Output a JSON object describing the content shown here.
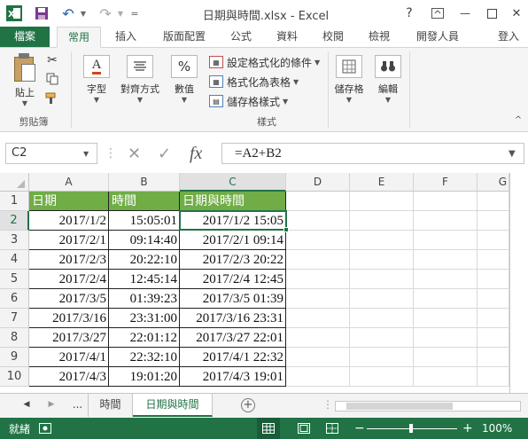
{
  "window": {
    "title": "日期與時間.xlsx - Excel",
    "help": "?",
    "qat_more": "=",
    "min": "—",
    "close": "✕"
  },
  "tabs": [
    "檔案",
    "常用",
    "插入",
    "版面配置",
    "公式",
    "資料",
    "校閱",
    "檢視",
    "開發人員"
  ],
  "signin": "登入",
  "ribbon": {
    "clipboard": {
      "paste": "貼上",
      "group": "剪貼簿"
    },
    "font": "字型",
    "alignment": "對齊方式",
    "number": "數值",
    "number_icon": "%",
    "styles": {
      "conditional": "設定格式化的條件",
      "as_table": "格式化為表格",
      "cell_styles": "儲存格樣式",
      "group": "樣式"
    },
    "cells": "儲存格",
    "editing": "編輯",
    "collapse": "^"
  },
  "formula_bar": {
    "name_box": "C2",
    "fx": "fx",
    "formula": "=A2+B2"
  },
  "grid": {
    "columns": [
      "A",
      "B",
      "C",
      "D",
      "E",
      "F",
      "G"
    ],
    "rows": [
      "1",
      "2",
      "3",
      "4",
      "5",
      "6",
      "7",
      "8",
      "9",
      "10"
    ],
    "header_row": [
      "日期",
      "時間",
      "日期與時間"
    ],
    "data": [
      [
        "2017/1/2",
        "15:05:01",
        "2017/1/2 15:05"
      ],
      [
        "2017/2/1",
        "09:14:40",
        "2017/2/1 09:14"
      ],
      [
        "2017/2/3",
        "20:22:10",
        "2017/2/3 20:22"
      ],
      [
        "2017/2/4",
        "12:45:14",
        "2017/2/4 12:45"
      ],
      [
        "2017/3/5",
        "01:39:23",
        "2017/3/5 01:39"
      ],
      [
        "2017/3/16",
        "23:31:00",
        "2017/3/16 23:31"
      ],
      [
        "2017/3/27",
        "22:01:12",
        "2017/3/27 22:01"
      ],
      [
        "2017/4/1",
        "22:32:10",
        "2017/4/1 22:32"
      ],
      [
        "2017/4/3",
        "19:01:20",
        "2017/4/3 19:01"
      ]
    ]
  },
  "sheets": {
    "ellipsis": "...",
    "tabs": [
      "時間",
      "日期與時間"
    ],
    "add": "+"
  },
  "status": {
    "ready": "就緒",
    "zoom": "100%",
    "zoom_minus": "−",
    "zoom_plus": "+"
  },
  "colors": {
    "accent": "#217346",
    "table_header": "#70ad47"
  }
}
